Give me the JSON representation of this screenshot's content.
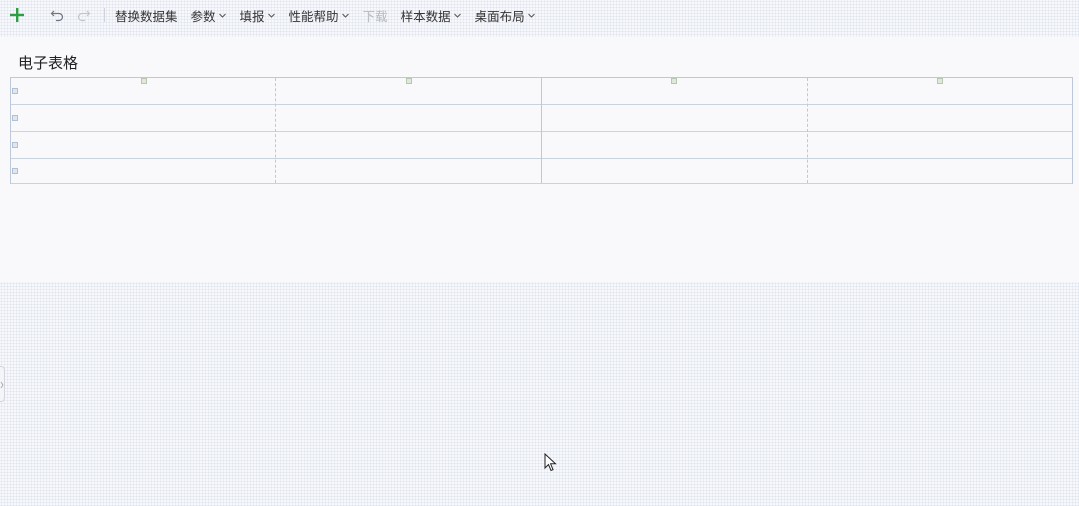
{
  "toolbar": {
    "items": [
      {
        "label": "替换数据集",
        "dropdown": false,
        "disabled": false
      },
      {
        "label": "参数",
        "dropdown": true,
        "disabled": false
      },
      {
        "label": "填报",
        "dropdown": true,
        "disabled": false
      },
      {
        "label": "性能帮助",
        "dropdown": true,
        "disabled": false
      },
      {
        "label": "下载",
        "dropdown": false,
        "disabled": true
      },
      {
        "label": "样本数据",
        "dropdown": true,
        "disabled": false
      },
      {
        "label": "桌面布局",
        "dropdown": true,
        "disabled": false
      }
    ],
    "add_icon": "plus-icon",
    "undo_icon": "undo-icon",
    "redo_icon": "redo-icon"
  },
  "component": {
    "title": "电子表格"
  },
  "sheet": {
    "columns": 4,
    "rows": 4
  },
  "colors": {
    "add_green": "#2e9e44",
    "grid_line": "#bcc9da",
    "disabled_text": "#b6b9bf"
  }
}
